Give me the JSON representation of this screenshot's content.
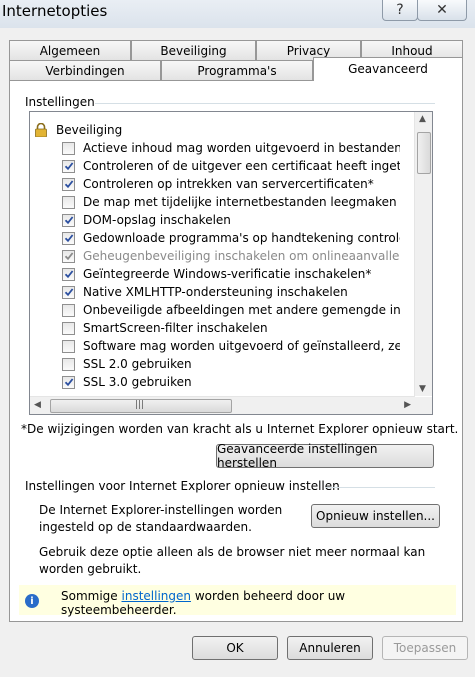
{
  "window": {
    "title": "Internetopties"
  },
  "tabs_back": [
    {
      "label": "Algemeen"
    },
    {
      "label": "Beveiliging"
    },
    {
      "label": "Privacy"
    },
    {
      "label": "Inhoud"
    }
  ],
  "tabs_front": [
    {
      "label": "Verbindingen"
    },
    {
      "label": "Programma's"
    },
    {
      "label": "Geavanceerd",
      "active": true
    }
  ],
  "settings": {
    "group_label": "Instellingen",
    "category": "Beveiliging",
    "items": [
      {
        "label": "Actieve inhoud mag worden uitgevoerd in bestanden in M",
        "checked": false,
        "enabled": true
      },
      {
        "label": "Controleren of de uitgever een certificaat heeft ingetrokke",
        "checked": true,
        "enabled": true
      },
      {
        "label": "Controleren op intrekken van servercertificaten*",
        "checked": true,
        "enabled": true
      },
      {
        "label": "De map met tijdelijke internetbestanden leegmaken wann",
        "checked": false,
        "enabled": true
      },
      {
        "label": "DOM-opslag inschakelen",
        "checked": true,
        "enabled": true
      },
      {
        "label": "Gedownloade programma's op handtekening controleren",
        "checked": true,
        "enabled": true
      },
      {
        "label": "Geheugenbeveiliging inschakelen om onlineaanvallen te he",
        "checked": true,
        "enabled": false
      },
      {
        "label": "Geïntegreerde Windows-verificatie inschakelen*",
        "checked": true,
        "enabled": true
      },
      {
        "label": "Native XMLHTTP-ondersteuning inschakelen",
        "checked": true,
        "enabled": true
      },
      {
        "label": "Onbeveiligde afbeeldingen met andere gemengde inhoud",
        "checked": false,
        "enabled": true
      },
      {
        "label": "SmartScreen-filter inschakelen",
        "checked": false,
        "enabled": true
      },
      {
        "label": "Software mag worden uitgevoerd of geïnstalleerd, zelfs a",
        "checked": false,
        "enabled": true
      },
      {
        "label": "SSL 2.0 gebruiken",
        "checked": false,
        "enabled": true
      },
      {
        "label": "SSL 3.0 gebruiken",
        "checked": true,
        "enabled": true
      }
    ],
    "note": "*De wijzigingen worden van kracht als u Internet Explorer opnieuw start.",
    "restore_button": "Geavanceerde instellingen herstellen"
  },
  "reset": {
    "group_label": "Instellingen voor Internet Explorer opnieuw instellen",
    "description_line1": "De Internet Explorer-instellingen worden",
    "description_line2": "ingesteld op de standaardwaarden.",
    "button": "Opnieuw instellen...",
    "hint_line1": "Gebruik deze optie alleen als de browser niet meer normaal kan",
    "hint_line2": "worden gebruikt."
  },
  "info": {
    "text_before": "Sommige ",
    "link": "instellingen",
    "text_after": " worden beheerd door uw systeembeheerder."
  },
  "footer": {
    "ok": "OK",
    "cancel": "Annuleren",
    "apply": "Toepassen"
  },
  "colors": {
    "checkmark": "#2b4fa0",
    "info_bg": "#ffffe1",
    "link": "#0066cc"
  }
}
